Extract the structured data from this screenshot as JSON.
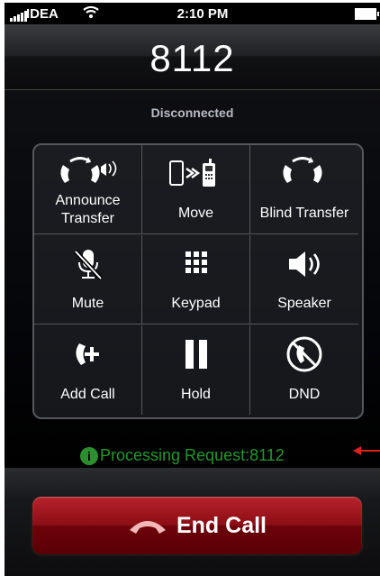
{
  "status_bar": {
    "carrier": "IDEA",
    "time": "2:10 PM"
  },
  "call": {
    "number": "8112",
    "status": "Disconnected"
  },
  "actions": [
    {
      "label": "Announce Transfer",
      "icon": "announce-transfer-icon"
    },
    {
      "label": "Move",
      "icon": "move-icon"
    },
    {
      "label": "Blind Transfer",
      "icon": "blind-transfer-icon"
    },
    {
      "label": "Mute",
      "icon": "mute-icon"
    },
    {
      "label": "Keypad",
      "icon": "keypad-icon"
    },
    {
      "label": "Speaker",
      "icon": "speaker-icon"
    },
    {
      "label": "Add Call",
      "icon": "add-call-icon"
    },
    {
      "label": "Hold",
      "icon": "hold-icon"
    },
    {
      "label": "DND",
      "icon": "dnd-icon"
    }
  ],
  "processing": {
    "text": "Processing Request:8112"
  },
  "end_call": {
    "label": "End Call"
  },
  "colors": {
    "processing_text": "#1f9a2a",
    "end_call_button": "#8d0e16",
    "annotation_arrow": "#e02020"
  }
}
